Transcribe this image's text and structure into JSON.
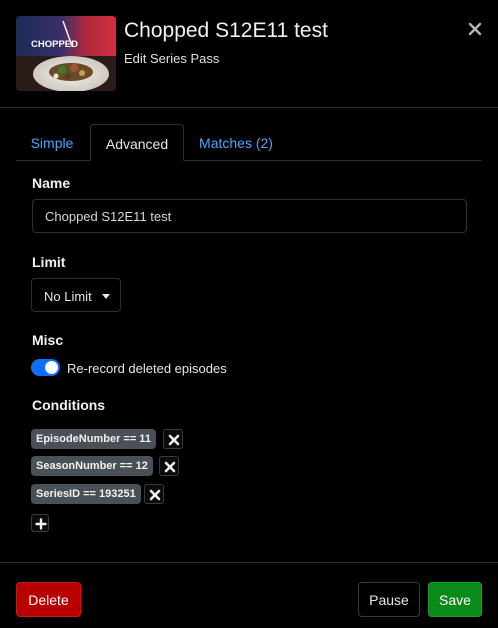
{
  "header": {
    "title": "Chopped S12E11 test",
    "subtitle": "Edit Series Pass",
    "thumbnail_logo_text": "CHOPPED",
    "close_icon": "close-icon"
  },
  "tabs": [
    {
      "label": "Simple",
      "active": false
    },
    {
      "label": "Advanced",
      "active": true
    },
    {
      "label": "Matches (2)",
      "active": false
    }
  ],
  "form": {
    "name_label": "Name",
    "name_value": "Chopped S12E11 test",
    "limit_label": "Limit",
    "limit_value": "No Limit",
    "misc_label": "Misc",
    "rerecord_label": "Re-record deleted episodes",
    "rerecord_enabled": true,
    "conditions_label": "Conditions",
    "conditions": [
      "EpisodeNumber == 11",
      "SeasonNumber == 12",
      "SeriesID == 193251"
    ]
  },
  "footer": {
    "delete_label": "Delete",
    "pause_label": "Pause",
    "save_label": "Save"
  },
  "colors": {
    "delete": "#b80000",
    "save": "#0a8a1a",
    "toggle": "#0d6efd",
    "tab_link": "#4aa3ff",
    "chip": "#495057"
  }
}
